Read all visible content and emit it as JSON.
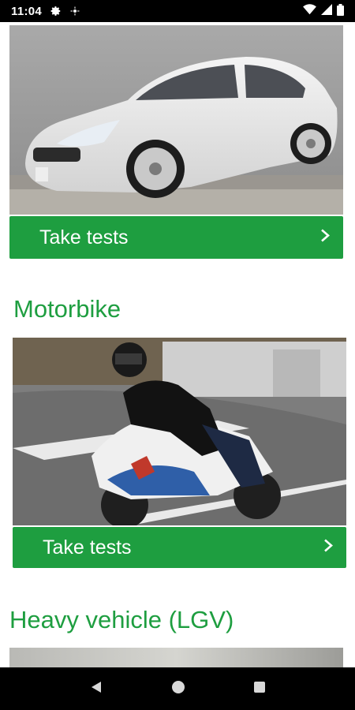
{
  "status_bar": {
    "time": "11:04",
    "icons": [
      "gear-icon",
      "location-icon",
      "wifi-icon",
      "signal-icon",
      "battery-icon"
    ]
  },
  "sections": [
    {
      "title": "",
      "button_label": "Take tests",
      "image": "car-photo"
    },
    {
      "title": "Motorbike",
      "button_label": "Take tests",
      "image": "motorbike-photo"
    },
    {
      "title": "Heavy vehicle (LGV)",
      "button_label": "",
      "image": "lgv-photo"
    }
  ],
  "nav_bar": {
    "icons": [
      "back-icon",
      "home-icon",
      "recents-icon"
    ]
  },
  "colors": {
    "accent": "#1e9e40",
    "status_bar": "#000000",
    "nav_bar": "#000000"
  }
}
